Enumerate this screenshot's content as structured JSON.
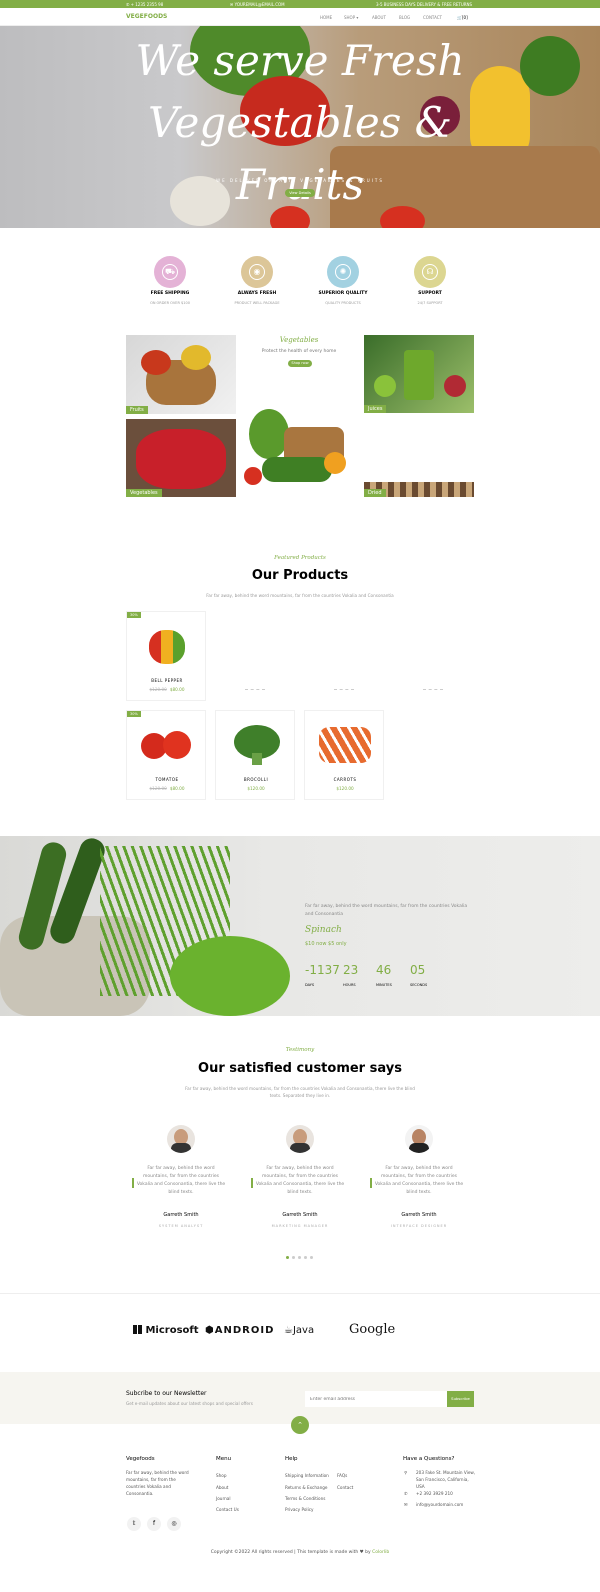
{
  "topbar": {
    "phone": "+ 1235 2355 98",
    "email": "YOUREMAIL@EMAIL.COM",
    "notice": "3-5 BUSINESS DAYS DELIVERY & FREE RETURNS"
  },
  "nav": {
    "logo": "VEGEFOODS",
    "items": [
      "HOME",
      "SHOP ▾",
      "ABOUT",
      "BLOG",
      "CONTACT"
    ],
    "cart": "[0]"
  },
  "hero": {
    "title": "We serve Fresh Vegestables & Fruits",
    "subtitle": "WE DELIVER ORGANIC VEGETABLES & FRUITS",
    "button": "View Details"
  },
  "services": [
    {
      "title": "FREE SHIPPING",
      "subtitle": "ON ORDER OVER $100",
      "color": "#e4b2d6",
      "icon": "truck-icon"
    },
    {
      "title": "ALWAYS FRESH",
      "subtitle": "PRODUCT WELL PACKAGE",
      "color": "#dcc698",
      "icon": "basket-icon"
    },
    {
      "title": "SUPERIOR QUALITY",
      "subtitle": "QUALITY PRODUCTS",
      "color": "#a2d1e1",
      "icon": "award-icon"
    },
    {
      "title": "SUPPORT",
      "subtitle": "24/7 SUPPORT",
      "color": "#dcd691",
      "icon": "headset-icon"
    }
  ],
  "categories": {
    "center_title": "Vegetables",
    "center_subtitle": "Protect the health of every home",
    "center_button": "Shop now",
    "labels": {
      "fruits": "Fruits",
      "vegetables": "Vegetables",
      "juices": "Juices",
      "dried": "Dried"
    }
  },
  "products": {
    "kicker": "Featured Products",
    "title": "Our Products",
    "description": "Far far away, behind the word mountains, far from the countries Vokalia and Consonantia",
    "items": [
      {
        "name": "BELL PEPPER",
        "old_price": "$120.00",
        "price": "$80.00",
        "badge": "30%"
      },
      {
        "name": "TOMATOE",
        "old_price": "$120.00",
        "price": "$80.00",
        "badge": "30%"
      },
      {
        "name": "BROCOLLI",
        "old_price": "",
        "price": "$120.00",
        "badge": ""
      },
      {
        "name": "CARROTS",
        "old_price": "",
        "price": "$120.00",
        "badge": ""
      }
    ]
  },
  "deal": {
    "description": "Far far away, behind the word mountains, far from the countries Vokalia and Consonantia",
    "name": "Spinach",
    "price": "$10 now $5 only",
    "countdown": [
      {
        "value": "-1137",
        "label": "DAYS"
      },
      {
        "value": "23",
        "label": "HOURS"
      },
      {
        "value": "46",
        "label": "MINUTES"
      },
      {
        "value": "05",
        "label": "SECONDS"
      }
    ]
  },
  "testimonials": {
    "kicker": "Testimony",
    "title": "Our satisfied customer says",
    "description": "Far far away, behind the word mountains, far from the countries Vokalia and Consonantia, there live the blind texts. Separated they live in.",
    "items": [
      {
        "text": "Far far away, behind the word mountains, far from the countries Vokalia and Consonantia, there live the blind texts.",
        "name": "Garreth Smith",
        "position": "SYSTEM ANALYST"
      },
      {
        "text": "Far far away, behind the word mountains, far from the countries Vokalia and Consonantia, there live the blind texts.",
        "name": "Garreth Smith",
        "position": "MARKETING MANAGER"
      },
      {
        "text": "Far far away, behind the word mountains, far from the countries Vokalia and Consonantia, there live the blind texts.",
        "name": "Garreth Smith",
        "position": "INTERFACE DESIGNER"
      }
    ]
  },
  "partners": [
    "Microsoft",
    "ANDROID",
    "Java",
    "Google"
  ],
  "newsletter": {
    "title": "Subcribe to our Newsletter",
    "subtitle": "Get e-mail updates about our latest shops and special offers",
    "placeholder": "Enter email address",
    "button": "Subscribe"
  },
  "footer": {
    "brand_title": "Vegefoods",
    "brand_text": "Far far away, behind the word mountains, far from the countries Vokalia and Consonantia.",
    "menu_title": "Menu",
    "menu": [
      "Shop",
      "About",
      "Journal",
      "Contact Us"
    ],
    "help_title": "Help",
    "help_col1": [
      "Shipping Information",
      "Returns & Exchange",
      "Terms & Conditions",
      "Privacy Policy"
    ],
    "help_col2": [
      "FAQs",
      "Contact"
    ],
    "questions_title": "Have a Questions?",
    "address": "203 Fake St. Mountain View, San Francisco, California, USA",
    "phone": "+2 392 3929 210",
    "email": "info@yourdomain.com",
    "copyright": "Copyright ©2022 All rights reserved | This template is made with",
    "by": "by",
    "credit": "Colorlib"
  },
  "colors": {
    "accent": "#82ae46"
  }
}
